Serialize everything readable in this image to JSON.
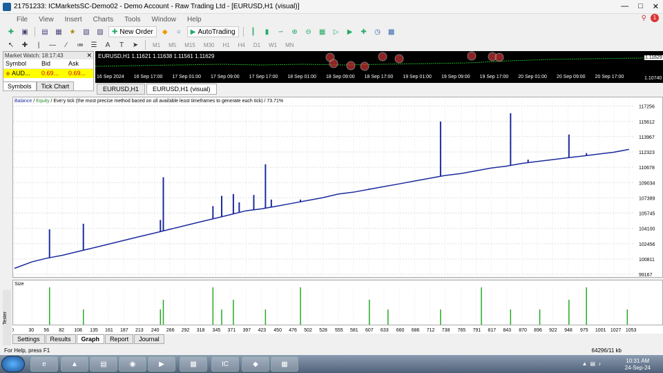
{
  "window": {
    "title": "21751233: ICMarketsSC-Demo02 - Demo Account - Raw Trading Ltd - [EURUSD,H1 (visual)]"
  },
  "menu": [
    "File",
    "View",
    "Insert",
    "Charts",
    "Tools",
    "Window",
    "Help"
  ],
  "toolbar": {
    "new_order": "New Order",
    "auto_trading": "AutoTrading"
  },
  "timeframes": [
    "M1",
    "M5",
    "M15",
    "M30",
    "H1",
    "H4",
    "D1",
    "W1",
    "MN"
  ],
  "market_watch": {
    "title": "Market Watch: 18:17:43",
    "columns": [
      "Symbol",
      "Bid",
      "Ask"
    ],
    "rows": [
      {
        "symbol": "AUD...",
        "bid": "0.69...",
        "ask": "0.69..."
      }
    ],
    "tabs": [
      "Symbols",
      "Tick Chart"
    ]
  },
  "chart": {
    "header": "EURUSD,H1 1.11621 1.11638 1.11561 1.11629",
    "price_labels": [
      "1.11629",
      "1.10740"
    ],
    "time_labels": [
      "16 Sep 2024",
      "16 Sep 17:00",
      "17 Sep 01:00",
      "17 Sep 09:00",
      "17 Sep 17:00",
      "18 Sep 01:00",
      "18 Sep 09:00",
      "18 Sep 17:00",
      "19 Sep 01:00",
      "19 Sep 09:00",
      "19 Sep 17:00",
      "20 Sep 01:00",
      "20 Sep 09:00",
      "20 Sep 17:00"
    ],
    "tabs": [
      "EURUSD,H1",
      "EURUSD,H1 (visual)"
    ]
  },
  "graph": {
    "header_balance": "Balance",
    "header_sep": " / ",
    "header_equity": "Equity",
    "header_rest": " / Every tick (the most precise method based on all available least timeframes to generate each tick) / 73.71%",
    "size_label": "Size",
    "colors": {
      "balance": "#1b2a9c",
      "equity": "#2a8a2a",
      "size": "#22aa22"
    }
  },
  "chart_data": {
    "type": "line",
    "title": "",
    "x": [
      0,
      30,
      56,
      82,
      108,
      135,
      161,
      187,
      213,
      240,
      266,
      292,
      318,
      345,
      371,
      397,
      423,
      450,
      476,
      502,
      528,
      555,
      581,
      607,
      633,
      660,
      686,
      712,
      738,
      765,
      791,
      817,
      843,
      870,
      896,
      922,
      948,
      975,
      1001,
      1027,
      1053
    ],
    "y_ticks": [
      117256,
      115612,
      113967,
      112323,
      110678,
      109034,
      107389,
      105745,
      104100,
      102456,
      100811,
      99167
    ],
    "ylim": [
      99167,
      117900
    ],
    "xlim": [
      0,
      1065
    ],
    "series": [
      {
        "name": "Balance",
        "values": [
          99800,
          100500,
          100900,
          101200,
          101600,
          102000,
          102400,
          102800,
          103200,
          103600,
          104000,
          104400,
          104800,
          105200,
          105600,
          106000,
          106200,
          106500,
          106800,
          107100,
          107400,
          107800,
          108000,
          108300,
          108600,
          108900,
          109200,
          109500,
          109800,
          110000,
          110300,
          110600,
          110800,
          111100,
          111300,
          111500,
          111700,
          111900,
          112100,
          112300,
          112600
        ]
      }
    ],
    "spikes": [
      {
        "x": 60,
        "y": 104000
      },
      {
        "x": 118,
        "y": 104600
      },
      {
        "x": 255,
        "y": 109600
      },
      {
        "x": 250,
        "y": 105000
      },
      {
        "x": 340,
        "y": 106500
      },
      {
        "x": 355,
        "y": 107600
      },
      {
        "x": 375,
        "y": 107800
      },
      {
        "x": 385,
        "y": 106900
      },
      {
        "x": 410,
        "y": 107700
      },
      {
        "x": 430,
        "y": 111000
      },
      {
        "x": 440,
        "y": 107200
      },
      {
        "x": 490,
        "y": 107200
      },
      {
        "x": 608,
        "y": 108400
      },
      {
        "x": 730,
        "y": 115600
      },
      {
        "x": 850,
        "y": 116500
      },
      {
        "x": 950,
        "y": 114200
      },
      {
        "x": 980,
        "y": 112200
      },
      {
        "x": 880,
        "y": 111500
      },
      {
        "x": 900,
        "y": 111300
      }
    ],
    "size_spikes": [
      60,
      118,
      250,
      255,
      340,
      355,
      375,
      430,
      490,
      608,
      640,
      730,
      800,
      850,
      900,
      950,
      980,
      1050
    ]
  },
  "tester_tabs": [
    "Settings",
    "Results",
    "Graph",
    "Report",
    "Journal"
  ],
  "tester_side_label": "Tester",
  "status": {
    "left": "For Help, press F1",
    "right": "64296/11 kb"
  },
  "clock": {
    "time": "10:31 AM",
    "date": "24-Sep-24"
  }
}
